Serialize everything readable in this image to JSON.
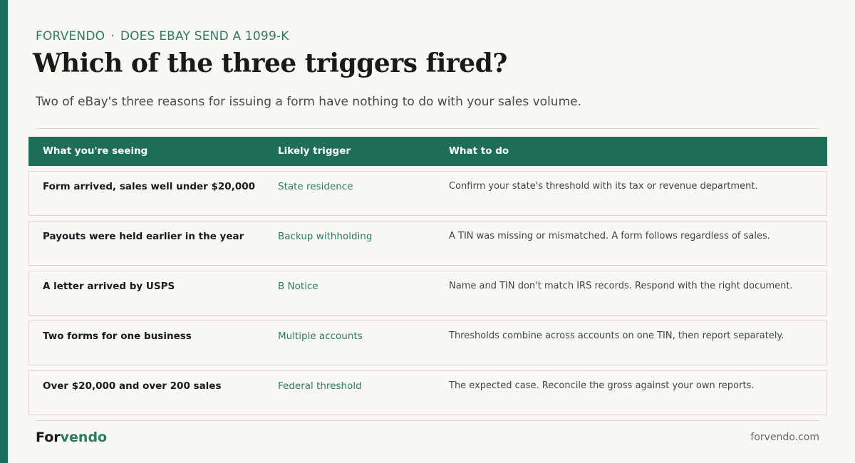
{
  "header": {
    "kicker_brand": "FORVENDO",
    "kicker_sep": "·",
    "kicker_topic": "DOES EBAY SEND A 1099-K",
    "title": "Which of the three triggers fired?",
    "subtitle": "Two of eBay's three reasons for issuing a form have nothing to do with your sales volume."
  },
  "table": {
    "columns": [
      "What you're seeing",
      "Likely trigger",
      "What to do"
    ],
    "rows": [
      {
        "seeing": "Form arrived, sales well under $20,000",
        "trigger": "State residence",
        "todo": "Confirm your state's threshold with its tax or revenue department."
      },
      {
        "seeing": "Payouts were held earlier in the year",
        "trigger": "Backup withholding",
        "todo": "A TIN was missing or mismatched. A form follows regardless of sales."
      },
      {
        "seeing": "A letter arrived by USPS",
        "trigger": "B Notice",
        "todo": "Name and TIN don't match IRS records. Respond with the right document."
      },
      {
        "seeing": "Two forms for one business",
        "trigger": "Multiple accounts",
        "todo": "Thresholds combine across accounts on one TIN, then report separately."
      },
      {
        "seeing": "Over $20,000 and over 200 sales",
        "trigger": "Federal threshold",
        "todo": "The expected case. Reconcile the gross against your own reports."
      }
    ]
  },
  "footer": {
    "brand_a": "For",
    "brand_b": "vendo",
    "domain": "forvendo.com"
  },
  "colors": {
    "accent": "#1d6f5a",
    "link_green": "#2f7a63",
    "background": "#f9f8f3"
  }
}
